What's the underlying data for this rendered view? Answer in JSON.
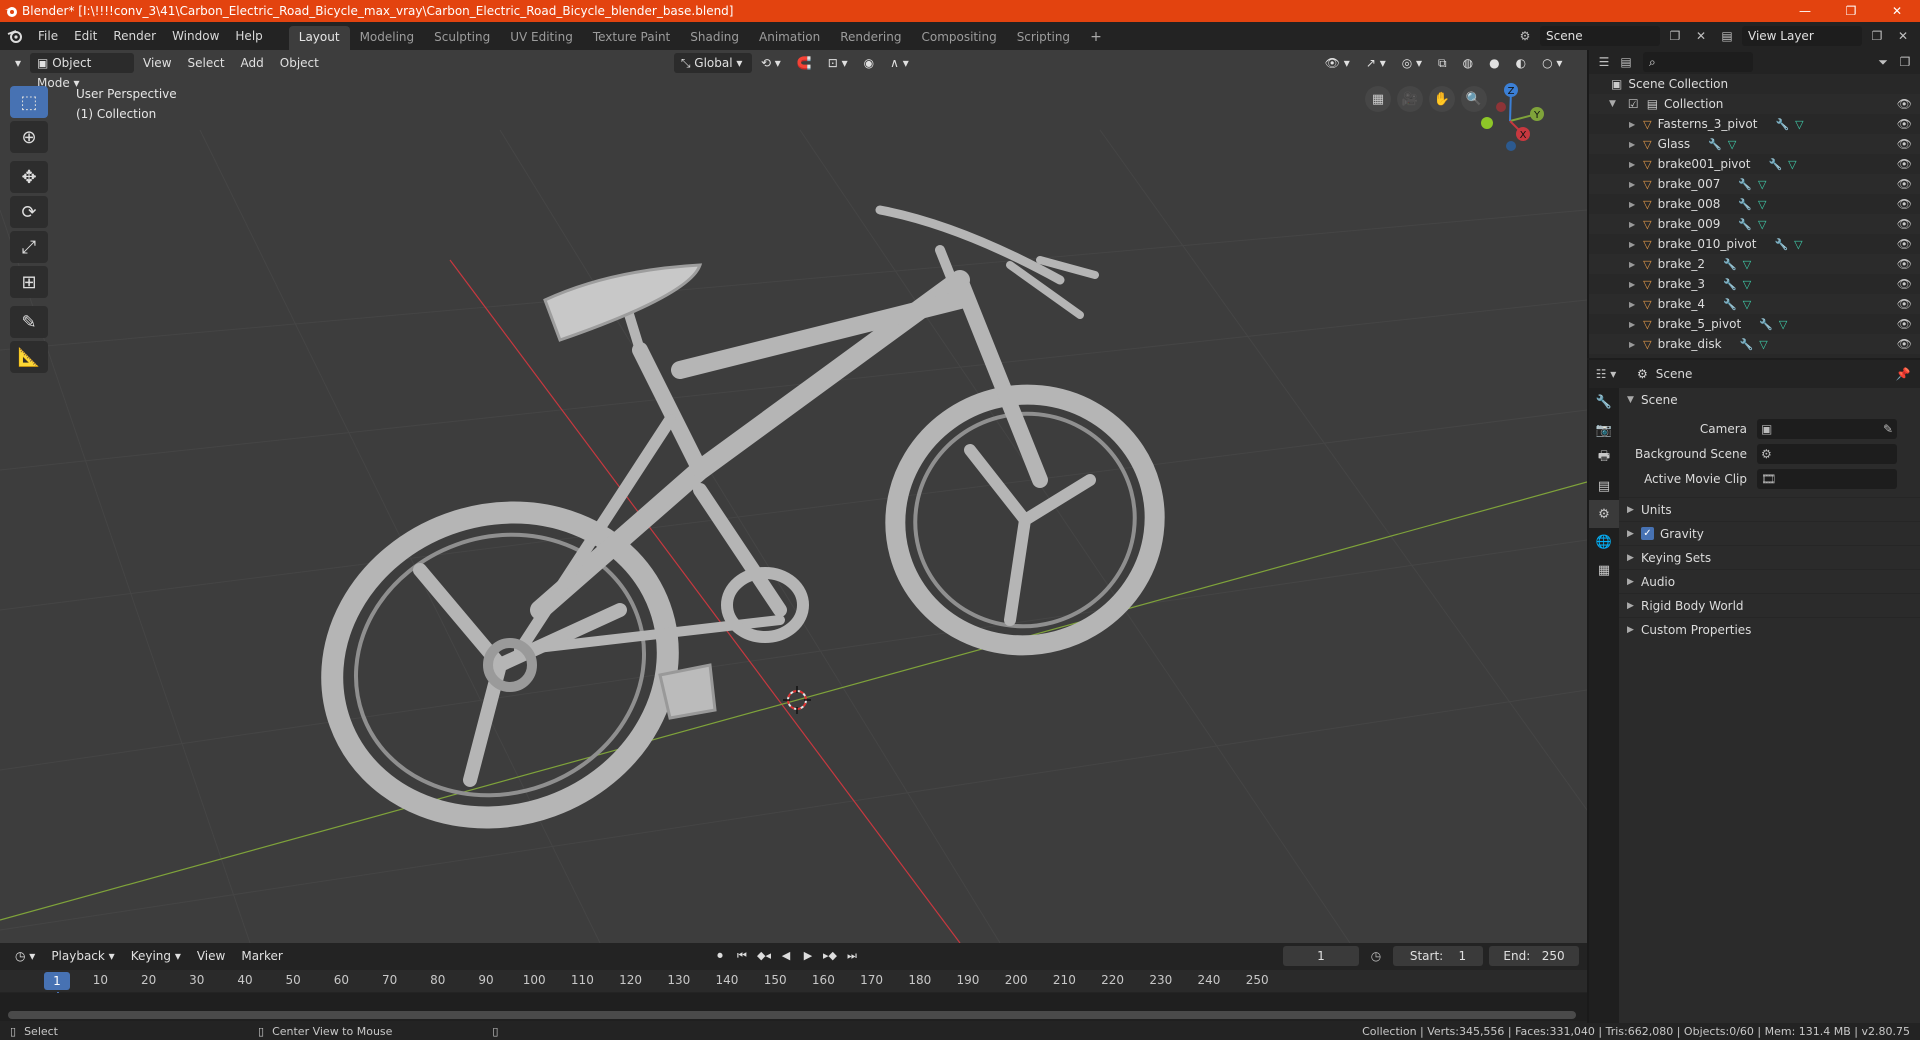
{
  "titlebar": {
    "title": "Blender* [I:\\!!!!conv_3\\41\\Carbon_Electric_Road_Bicycle_max_vray\\Carbon_Electric_Road_Bicycle_blender_base.blend]",
    "minimize": "—",
    "maximize": "❐",
    "close": "✕"
  },
  "menu": {
    "items": [
      "File",
      "Edit",
      "Render",
      "Window",
      "Help"
    ]
  },
  "workspaces": {
    "tabs": [
      "Layout",
      "Modeling",
      "Sculpting",
      "UV Editing",
      "Texture Paint",
      "Shading",
      "Animation",
      "Rendering",
      "Compositing",
      "Scripting"
    ],
    "active": "Layout",
    "add": "+"
  },
  "topright": {
    "scene": "Scene",
    "view_layer": "View Layer"
  },
  "viewport": {
    "mode": "Object Mode",
    "menus": [
      "View",
      "Select",
      "Add",
      "Object"
    ],
    "orientation": "Global",
    "info_line1": "User Perspective",
    "info_line2": "(1) Collection",
    "gizmo": {
      "x": "X",
      "y": "Y",
      "z": "Z"
    }
  },
  "timeline": {
    "menus": [
      "Playback",
      "Keying",
      "View",
      "Marker"
    ],
    "current_frame": "1",
    "start_label": "Start:",
    "start": "1",
    "end_label": "End:",
    "end": "250",
    "ticks": [
      "1",
      "10",
      "20",
      "30",
      "40",
      "50",
      "60",
      "70",
      "80",
      "90",
      "100",
      "110",
      "120",
      "130",
      "140",
      "150",
      "160",
      "170",
      "180",
      "190",
      "200",
      "210",
      "220",
      "230",
      "240",
      "250"
    ]
  },
  "statusbar": {
    "left1": "Select",
    "left2": "Center View to Mouse",
    "right": "Collection | Verts:345,556 | Faces:331,040 | Tris:662,080 | Objects:0/60 | Mem: 131.4 MB | v2.80.75"
  },
  "outliner": {
    "root": "Scene Collection",
    "collection": "Collection",
    "items": [
      "Fasterns_3_pivot",
      "Glass",
      "brake001_pivot",
      "brake_007",
      "brake_008",
      "brake_009",
      "brake_010_pivot",
      "brake_2",
      "brake_3",
      "brake_4",
      "brake_5_pivot",
      "brake_disk"
    ]
  },
  "properties": {
    "header": "Scene",
    "panel": "Scene",
    "camera_label": "Camera",
    "bg_scene_label": "Background Scene",
    "movie_clip_label": "Active Movie Clip",
    "subpanels": [
      "Units",
      "Gravity",
      "Keying Sets",
      "Audio",
      "Rigid Body World",
      "Custom Properties"
    ]
  },
  "colors": {
    "titlebar": "#e3430f",
    "accent": "#4772b3",
    "viewport_bg": "#3d3d3d",
    "x_axis": "#c7383f",
    "y_axis": "#7fa33a"
  }
}
